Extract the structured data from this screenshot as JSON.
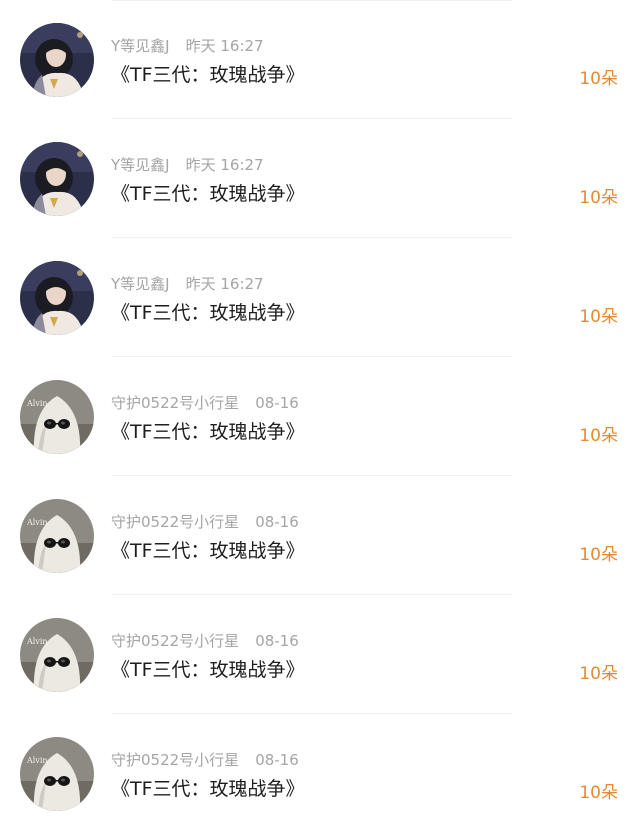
{
  "rows": [
    {
      "user": "Y等见鑫J",
      "time": "昨天 16:27",
      "title": "《TF三代：玫瑰战争》",
      "count": "10朵",
      "avatar": "girl-avatar"
    },
    {
      "user": "Y等见鑫J",
      "time": "昨天 16:27",
      "title": "《TF三代：玫瑰战争》",
      "count": "10朵",
      "avatar": "girl-avatar"
    },
    {
      "user": "Y等见鑫J",
      "time": "昨天 16:27",
      "title": "《TF三代：玫瑰战争》",
      "count": "10朵",
      "avatar": "girl-avatar"
    },
    {
      "user": "守护0522号小行星",
      "time": "08-16",
      "title": "《TF三代：玫瑰战争》",
      "count": "10朵",
      "avatar": "ghost-avatar",
      "avatar_text": "Alvin"
    },
    {
      "user": "守护0522号小行星",
      "time": "08-16",
      "title": "《TF三代：玫瑰战争》",
      "count": "10朵",
      "avatar": "ghost-avatar",
      "avatar_text": "Alvin"
    },
    {
      "user": "守护0522号小行星",
      "time": "08-16",
      "title": "《TF三代：玫瑰战争》",
      "count": "10朵",
      "avatar": "ghost-avatar",
      "avatar_text": "Alvin"
    },
    {
      "user": "守护0522号小行星",
      "time": "08-16",
      "title": "《TF三代：玫瑰战争》",
      "count": "10朵",
      "avatar": "ghost-avatar",
      "avatar_text": "Alvin"
    }
  ],
  "colors": {
    "username": "#a5a5a5",
    "title": "#1e1e1e",
    "count_accent": "#e58a33",
    "divider": "#f1f1f1"
  }
}
